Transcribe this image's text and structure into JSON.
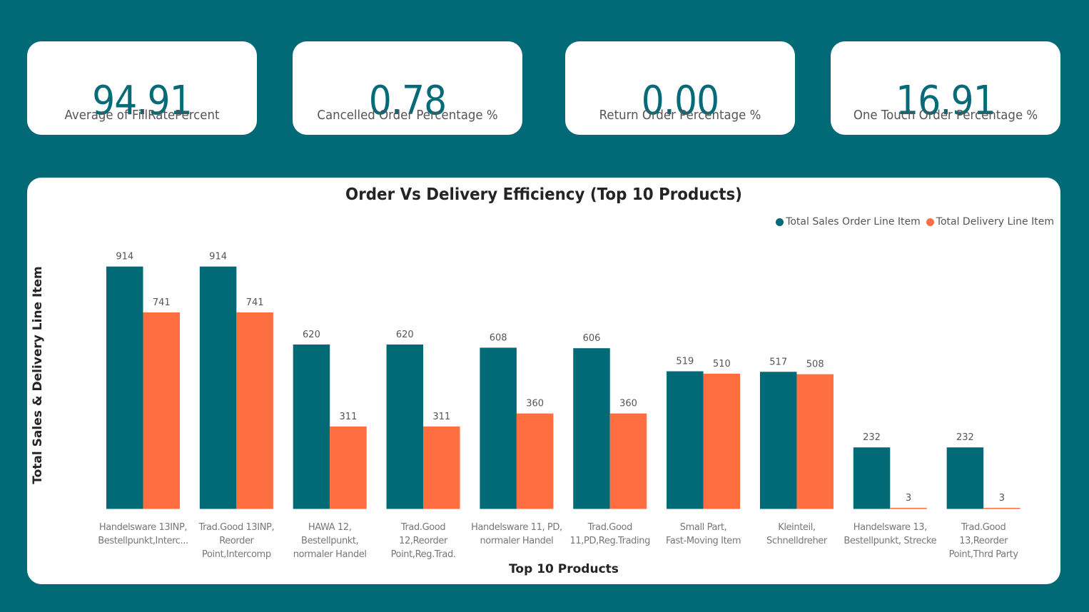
{
  "kpis": [
    {
      "value": "94.91",
      "label": "Average of FillRatePercent"
    },
    {
      "value": "0.78",
      "label": "Cancelled Order Percentage %"
    },
    {
      "value": "0.00",
      "label": "Return Order Percentage %"
    },
    {
      "value": "16.91",
      "label": "One Touch Order Percentage %"
    }
  ],
  "colors": {
    "background": "#026977",
    "series_sales": "#026977",
    "series_delivery": "#FF6E40"
  },
  "chart_data": {
    "type": "bar",
    "title": "Order Vs Delivery Efficiency (Top 10 Products)",
    "xlabel": "Top 10 Products",
    "ylabel": "Total Sales & Delivery Line Item",
    "legend_position": "top-right",
    "grid": false,
    "ylim": [
      0,
      1000
    ],
    "categories": [
      [
        "Handelsware 13INP,",
        "Bestellpunkt,Interc..."
      ],
      [
        "Trad.Good 13INP,",
        "Reorder",
        "Point,Intercomp"
      ],
      [
        "HAWA 12,",
        "Bestellpunkt,",
        "normaler Handel"
      ],
      [
        "Trad.Good",
        "12,Reorder",
        "Point,Reg.Trad."
      ],
      [
        "Handelsware 11, PD,",
        "normaler Handel"
      ],
      [
        "Trad.Good",
        "11,PD,Reg.Trading"
      ],
      [
        "Small Part,",
        "Fast-Moving Item"
      ],
      [
        "Kleinteil,",
        "Schnelldreher"
      ],
      [
        "Handelsware 13,",
        "Bestellpunkt, Strecke"
      ],
      [
        "Trad.Good",
        "13,Reorder",
        "Point,Thrd Party"
      ]
    ],
    "series": [
      {
        "name": "Total Sales Order Line Item",
        "values": [
          914,
          914,
          620,
          620,
          608,
          606,
          519,
          517,
          232,
          232
        ]
      },
      {
        "name": "Total Delivery Line Item",
        "values": [
          741,
          741,
          311,
          311,
          360,
          360,
          510,
          508,
          3,
          3
        ]
      }
    ]
  }
}
